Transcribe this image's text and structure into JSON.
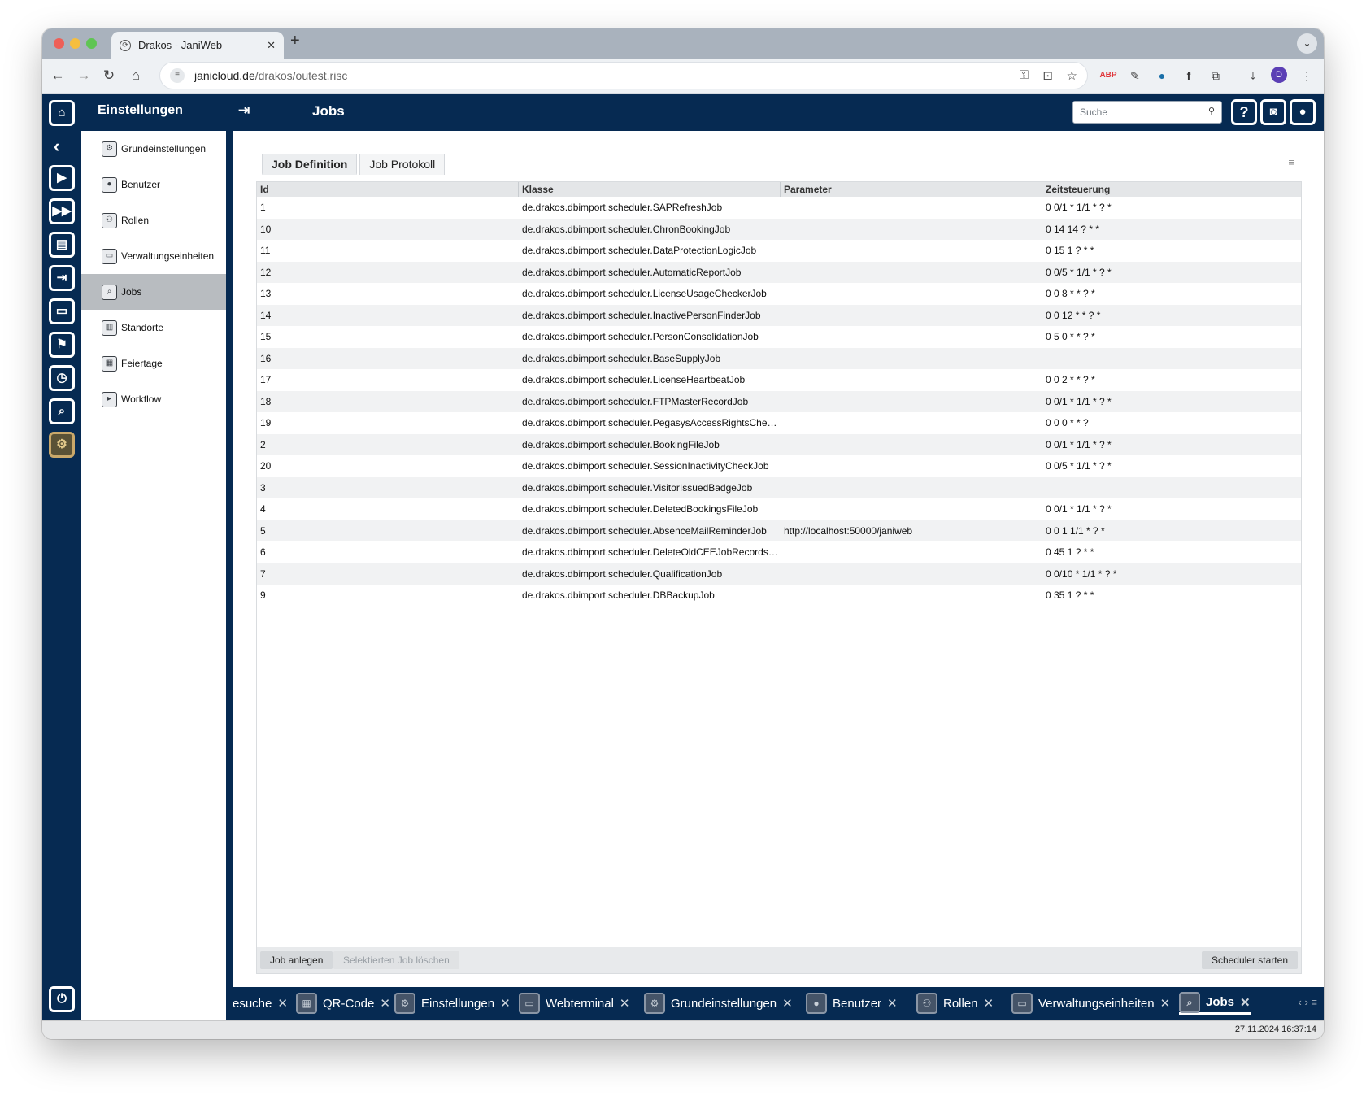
{
  "browser": {
    "tab_title": "Drakos - JaniWeb",
    "url_host": "janicloud.de",
    "url_path": "/drakos/outest.risc",
    "profile_initial": "D"
  },
  "header": {
    "section": "Einstellungen",
    "title": "Jobs",
    "search_placeholder": "Suche"
  },
  "sidebar": {
    "items": [
      {
        "label": "Grundeinstellungen",
        "icon": "gear-icon"
      },
      {
        "label": "Benutzer",
        "icon": "user-icon"
      },
      {
        "label": "Rollen",
        "icon": "users-icon"
      },
      {
        "label": "Verwaltungseinheiten",
        "icon": "monitor-icon"
      },
      {
        "label": "Jobs",
        "icon": "search-icon",
        "active": true
      },
      {
        "label": "Standorte",
        "icon": "building-icon"
      },
      {
        "label": "Feiertage",
        "icon": "calendar-icon"
      },
      {
        "label": "Workflow",
        "icon": "workflow-icon"
      }
    ]
  },
  "tabs": [
    "Job Definition",
    "Job Protokoll"
  ],
  "table": {
    "columns": [
      "Id",
      "Klasse",
      "Parameter",
      "Zeitsteuerung"
    ],
    "rows": [
      [
        "1",
        "de.drakos.dbimport.scheduler.SAPRefreshJob",
        "",
        "0 0/1 * 1/1 * ? *"
      ],
      [
        "10",
        "de.drakos.dbimport.scheduler.ChronBookingJob",
        "",
        "0 14 14 ? * *"
      ],
      [
        "11",
        "de.drakos.dbimport.scheduler.DataProtectionLogicJob",
        "",
        "0 15 1 ? * *"
      ],
      [
        "12",
        "de.drakos.dbimport.scheduler.AutomaticReportJob",
        "",
        "0 0/5 * 1/1 * ? *"
      ],
      [
        "13",
        "de.drakos.dbimport.scheduler.LicenseUsageCheckerJob",
        "",
        "0 0 8 * * ? *"
      ],
      [
        "14",
        "de.drakos.dbimport.scheduler.InactivePersonFinderJob",
        "",
        "0 0 12 * * ? *"
      ],
      [
        "15",
        "de.drakos.dbimport.scheduler.PersonConsolidationJob",
        "",
        "0 5 0 * * ? *"
      ],
      [
        "16",
        "de.drakos.dbimport.scheduler.BaseSupplyJob",
        "",
        ""
      ],
      [
        "17",
        "de.drakos.dbimport.scheduler.LicenseHeartbeatJob",
        "",
        "0 0 2 * * ? *"
      ],
      [
        "18",
        "de.drakos.dbimport.scheduler.FTPMasterRecordJob",
        "",
        "0 0/1 * 1/1 * ? *"
      ],
      [
        "19",
        "de.drakos.dbimport.scheduler.PegasysAccessRightsChecke...",
        "",
        "0 0 0 * * ?"
      ],
      [
        "2",
        "de.drakos.dbimport.scheduler.BookingFileJob",
        "",
        "0 0/1 * 1/1 * ? *"
      ],
      [
        "20",
        "de.drakos.dbimport.scheduler.SessionInactivityCheckJob",
        "",
        "0 0/5 * 1/1 * ? *"
      ],
      [
        "3",
        "de.drakos.dbimport.scheduler.VisitorIssuedBadgeJob",
        "",
        ""
      ],
      [
        "4",
        "de.drakos.dbimport.scheduler.DeletedBookingsFileJob",
        "",
        "0 0/1 * 1/1 * ? *"
      ],
      [
        "5",
        "de.drakos.dbimport.scheduler.AbsenceMailReminderJob",
        "http://localhost:50000/janiweb",
        "0 0 1 1/1 * ? *"
      ],
      [
        "6",
        "de.drakos.dbimport.scheduler.DeleteOldCEEJobRecordsJob",
        "",
        "0 45 1 ? * *"
      ],
      [
        "7",
        "de.drakos.dbimport.scheduler.QualificationJob",
        "",
        "0 0/10 * 1/1 * ? *"
      ],
      [
        "9",
        "de.drakos.dbimport.scheduler.DBBackupJob",
        "",
        "0 35 1 ? * *"
      ]
    ]
  },
  "footer_buttons": {
    "create": "Job anlegen",
    "delete": "Selektierten Job löschen",
    "start": "Scheduler starten"
  },
  "bottom_tabs": [
    {
      "label": "esuche",
      "icon": ""
    },
    {
      "label": "QR-Code",
      "icon": "qr-icon"
    },
    {
      "label": "Einstellungen",
      "icon": "gear-icon"
    },
    {
      "label": "Webterminal",
      "icon": "monitor-icon"
    },
    {
      "label": "Grundeinstellungen",
      "icon": "gear-icon"
    },
    {
      "label": "Benutzer",
      "icon": "user-icon"
    },
    {
      "label": "Rollen",
      "icon": "users-icon"
    },
    {
      "label": "Verwaltungseinheiten",
      "icon": "monitor-icon"
    },
    {
      "label": "Jobs",
      "icon": "search-icon",
      "active": true
    }
  ],
  "status": {
    "datetime": "27.11.2024 16:37:14"
  }
}
